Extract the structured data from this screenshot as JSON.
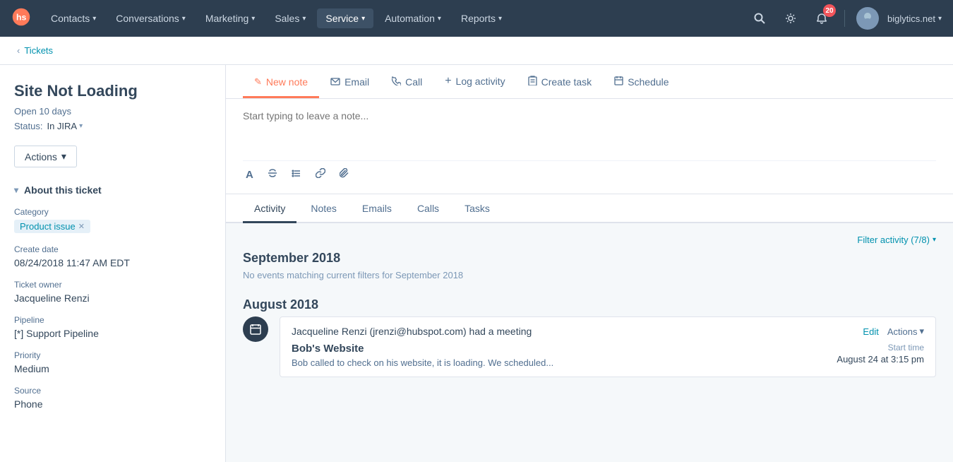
{
  "topnav": {
    "logo_alt": "HubSpot logo",
    "nav_items": [
      {
        "label": "Contacts",
        "id": "contacts",
        "active": false
      },
      {
        "label": "Conversations",
        "id": "conversations",
        "active": false
      },
      {
        "label": "Marketing",
        "id": "marketing",
        "active": false
      },
      {
        "label": "Sales",
        "id": "sales",
        "active": false
      },
      {
        "label": "Service",
        "id": "service",
        "active": true
      },
      {
        "label": "Automation",
        "id": "automation",
        "active": false
      },
      {
        "label": "Reports",
        "id": "reports",
        "active": false
      }
    ],
    "notification_count": "20",
    "account_name": "biglytics.net"
  },
  "breadcrumb": {
    "back_label": "Tickets"
  },
  "ticket": {
    "title": "Site Not Loading",
    "open_label": "Open 10 days",
    "status_label": "Status:",
    "status_value": "In JIRA",
    "actions_label": "Actions"
  },
  "about_section": {
    "heading": "About this ticket",
    "fields": [
      {
        "label": "Category",
        "type": "tag",
        "tag_value": "Product issue"
      },
      {
        "label": "Create date",
        "type": "text",
        "value": "08/24/2018 11:47 AM EDT"
      },
      {
        "label": "Ticket owner",
        "type": "text",
        "value": "Jacqueline Renzi"
      },
      {
        "label": "Pipeline",
        "type": "text",
        "value": "[*] Support Pipeline"
      },
      {
        "label": "Priority",
        "type": "text",
        "value": "Medium"
      },
      {
        "label": "Source",
        "type": "text",
        "value": "Phone"
      }
    ]
  },
  "action_tabs": [
    {
      "id": "new-note",
      "label": "New note",
      "icon": "✏️",
      "active": true
    },
    {
      "id": "email",
      "label": "Email",
      "icon": "✉️",
      "active": false
    },
    {
      "id": "call",
      "label": "Call",
      "icon": "📞",
      "active": false
    },
    {
      "id": "log-activity",
      "label": "Log activity",
      "icon": "+",
      "active": false
    },
    {
      "id": "create-task",
      "label": "Create task",
      "icon": "📋",
      "active": false
    },
    {
      "id": "schedule",
      "label": "Schedule",
      "icon": "📅",
      "active": false
    }
  ],
  "note_editor": {
    "placeholder": "Start typing to leave a note..."
  },
  "activity_tabs": [
    {
      "id": "activity",
      "label": "Activity",
      "active": true
    },
    {
      "id": "notes",
      "label": "Notes",
      "active": false
    },
    {
      "id": "emails",
      "label": "Emails",
      "active": false
    },
    {
      "id": "calls",
      "label": "Calls",
      "active": false
    },
    {
      "id": "tasks",
      "label": "Tasks",
      "active": false
    }
  ],
  "filter_activity": {
    "label": "Filter activity (7/8)"
  },
  "feed": {
    "sections": [
      {
        "month": "September 2018",
        "no_events_text": "No events matching current filters for September 2018",
        "items": []
      },
      {
        "month": "August 2018",
        "no_events_text": null,
        "items": [
          {
            "icon": "📅",
            "actor": "Jacqueline Renzi (jrenzi@hubspot.com) had a meeting",
            "edit_label": "Edit",
            "actions_label": "Actions",
            "card_title": "Bob's Website",
            "card_body": "Bob called to check on his website, it is loading. We scheduled...",
            "start_time_label": "Start time",
            "start_time_value": "August 24 at 3:15 pm"
          }
        ]
      }
    ]
  },
  "colors": {
    "accent_orange": "#ff7a59",
    "nav_bg": "#2d3e50",
    "link_blue": "#0091ae"
  }
}
